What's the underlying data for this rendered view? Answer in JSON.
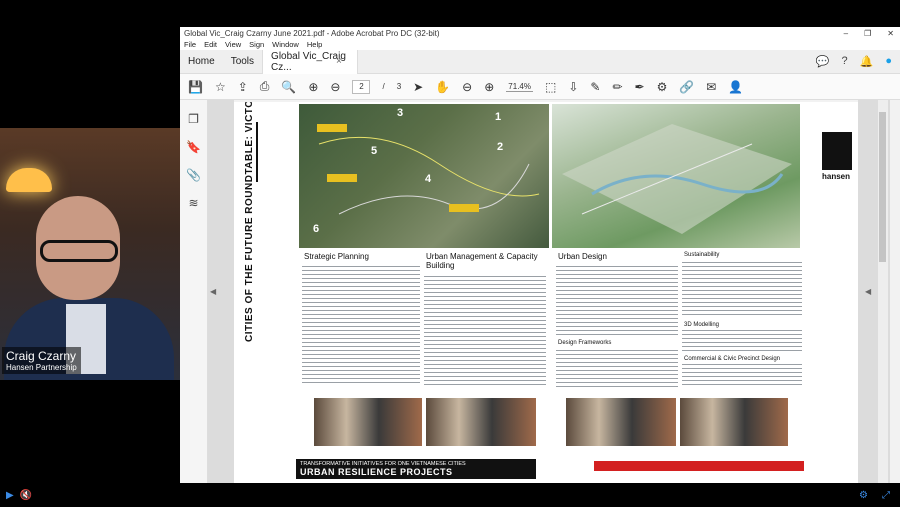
{
  "window": {
    "title": "Global Vic_Craig Czarny June 2021.pdf - Adobe Acrobat Pro DC (32-bit)",
    "minimize": "–",
    "restore": "❐",
    "close": "✕"
  },
  "menu": [
    "File",
    "Edit",
    "View",
    "Sign",
    "Window",
    "Help"
  ],
  "tabs": {
    "home": "Home",
    "tools": "Tools",
    "doc": "Global Vic_Craig Cz...",
    "doc_close": "×"
  },
  "toolbar": {
    "page_current": "2",
    "page_sep": "/",
    "page_total": "3",
    "zoom": "71.4%"
  },
  "participant": {
    "name": "Craig Czarny",
    "company": "Hansen Partnership"
  },
  "document": {
    "vertical_title": "CITIES OF THE FUTURE ROUNDTABLE: VICTORIA",
    "logo_text": "hansen",
    "col1_heading": "Strategic Planning",
    "col2_heading": "Urban Management & Capacity Building",
    "col3_heading": "Urban Design",
    "col4_heading": "Sustainability",
    "col3_sub": "Design Frameworks",
    "col4_sub1": "3D Modelling",
    "col4_sub2": "Commercial & Civic Precinct Design",
    "banner_line1": "TRANSFORMATIVE INITIATIVES FOR ONE VIETNAMESE CITIES",
    "banner_line2": "URBAN RESILIENCE PROJECTS",
    "map_labels": [
      "3",
      "1",
      "2",
      "5",
      "4",
      "6"
    ]
  },
  "colors": {
    "accent": "#3b8be6",
    "banner": "#111111",
    "red": "#d32020"
  }
}
